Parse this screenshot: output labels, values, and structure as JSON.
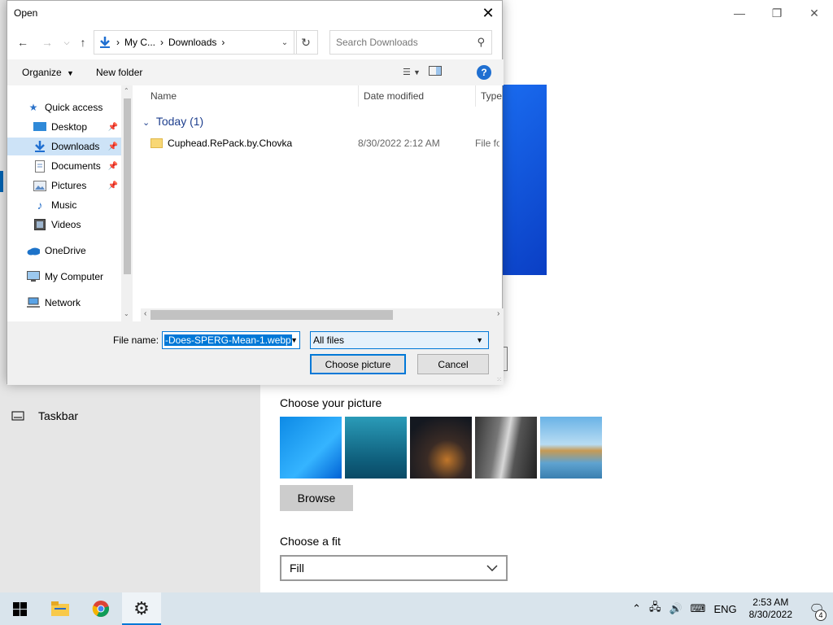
{
  "dialog": {
    "title": "Open",
    "address": {
      "segments": [
        "My C...",
        "Downloads"
      ]
    },
    "search_placeholder": "Search Downloads",
    "toolbar": {
      "organize": "Organize",
      "new_folder": "New folder"
    },
    "nav": [
      {
        "label": "Quick access",
        "icon": "star-icon"
      },
      {
        "label": "Desktop",
        "icon": "desktop-icon",
        "pinned": true
      },
      {
        "label": "Downloads",
        "icon": "download-icon",
        "pinned": true,
        "selected": true
      },
      {
        "label": "Documents",
        "icon": "document-icon",
        "pinned": true
      },
      {
        "label": "Pictures",
        "icon": "pictures-icon",
        "pinned": true
      },
      {
        "label": "Music",
        "icon": "music-icon"
      },
      {
        "label": "Videos",
        "icon": "video-icon"
      },
      {
        "label": "OneDrive",
        "icon": "cloud-icon"
      },
      {
        "label": "My Computer",
        "icon": "computer-icon"
      },
      {
        "label": "Network",
        "icon": "network-icon"
      }
    ],
    "columns": [
      "Name",
      "Date modified",
      "Type"
    ],
    "group": "Today (1)",
    "files": [
      {
        "name": "Cuphead.RePack.by.Chovka",
        "date": "8/30/2022 2:12 AM",
        "type": "File fo"
      }
    ],
    "file_name_label": "File name:",
    "file_name_value": "-Does-SPERG-Mean-1.webp",
    "filter": "All files",
    "ok_label": "Choose picture",
    "cancel_label": "Cancel"
  },
  "settings": {
    "taskbar_nav_label": "Taskbar",
    "choose_picture_label": "Choose your picture",
    "browse_label": "Browse",
    "choose_fit_label": "Choose a fit",
    "fit_value": "Fill"
  },
  "system_tray": {
    "language": "ENG",
    "time": "2:53 AM",
    "date": "8/30/2022",
    "notification_count": "4"
  },
  "colors": {
    "accent": "#0078d7",
    "selection": "#cde3f7"
  }
}
